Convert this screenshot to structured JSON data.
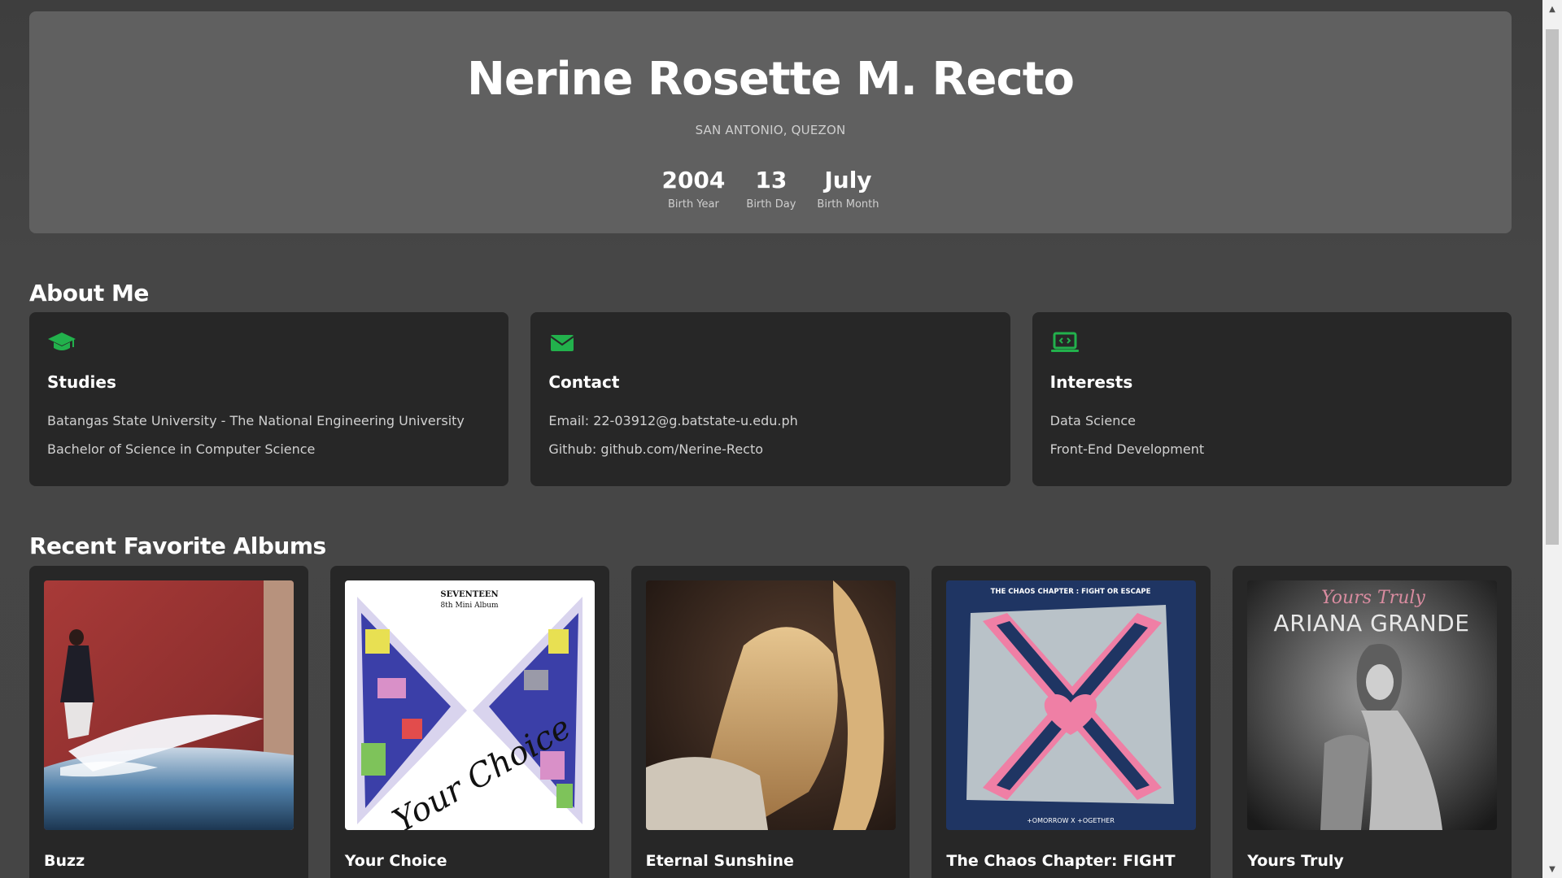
{
  "profile": {
    "name": "Nerine Rosette M. Recto",
    "location": "SAN ANTONIO, QUEZON",
    "stats": [
      {
        "value": "2004",
        "label": "Birth Year"
      },
      {
        "value": "13",
        "label": "Birth Day"
      },
      {
        "value": "July",
        "label": "Birth Month"
      }
    ]
  },
  "about": {
    "title": "About Me",
    "cards": [
      {
        "icon": "graduation-cap-icon",
        "title": "Studies",
        "lines": [
          "Batangas State University - The National Engineering University",
          "Bachelor of Science in Computer Science"
        ]
      },
      {
        "icon": "envelope-icon",
        "title": "Contact",
        "lines": [
          "Email: 22-03912@g.batstate-u.edu.ph",
          "Github: github.com/Nerine-Recto"
        ]
      },
      {
        "icon": "laptop-code-icon",
        "title": "Interests",
        "lines": [
          "Data Science",
          "Front-End Development"
        ]
      }
    ]
  },
  "albums": {
    "title": "Recent Favorite Albums",
    "items": [
      {
        "title": "Buzz"
      },
      {
        "title": "Your Choice",
        "cover_text": [
          "SEVENTEEN",
          "8th Mini Album",
          "Your Choice"
        ]
      },
      {
        "title": "Eternal Sunshine"
      },
      {
        "title": "The Chaos Chapter: FIGHT OR ESCAPE",
        "cover_text": [
          "THE CHAOS CHAPTER : FIGHT OR ESCAPE",
          "+OMORROW X +OGETHER"
        ]
      },
      {
        "title": "Yours Truly",
        "cover_text": [
          "Yours Truly",
          "ARIANA GRANDE"
        ]
      }
    ]
  },
  "colors": {
    "accent": "#22b14c",
    "card_bg": "#272727",
    "hero_bg": "#606060",
    "page_bg": "#454545"
  }
}
